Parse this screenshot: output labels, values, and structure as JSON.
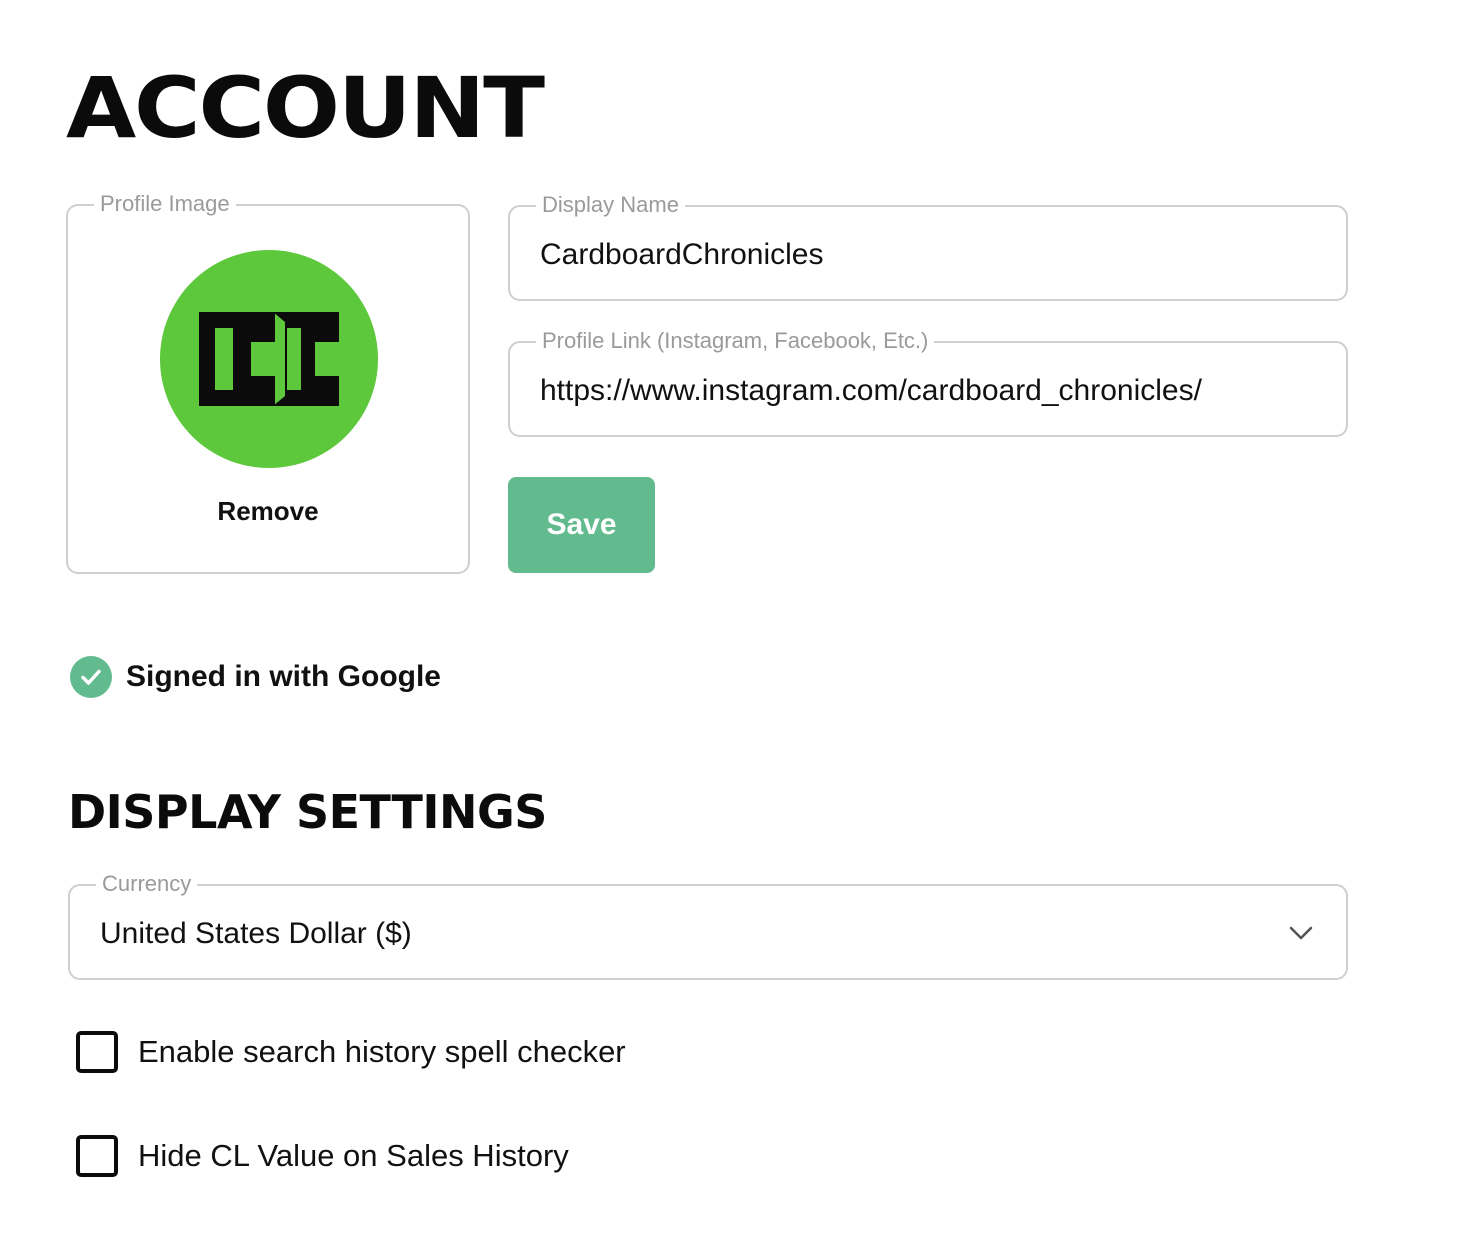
{
  "page": {
    "title": "ACCOUNT"
  },
  "profile_image": {
    "legend": "Profile Image",
    "avatar_bg": "#5ec83c",
    "remove_label": "Remove"
  },
  "display_name": {
    "legend": "Display Name",
    "value": "CardboardChronicles"
  },
  "profile_link": {
    "legend": "Profile Link (Instagram, Facebook, Etc.)",
    "value": "https://www.instagram.com/cardboard_chronicles/"
  },
  "save": {
    "label": "Save",
    "color": "#62bb8e"
  },
  "auth": {
    "status": "Signed in with Google",
    "icon": "check-circle-icon"
  },
  "display_settings": {
    "title": "DISPLAY SETTINGS",
    "currency": {
      "legend": "Currency",
      "selected": "United States Dollar ($)"
    },
    "options": [
      {
        "label": "Enable search history spell checker",
        "checked": false
      },
      {
        "label": "Hide CL Value on Sales History",
        "checked": false
      }
    ]
  }
}
